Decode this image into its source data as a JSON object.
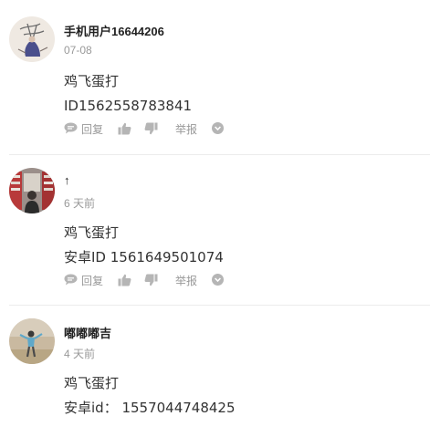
{
  "comments": [
    {
      "username": "手机用户16644206",
      "time": "07-08",
      "lines": [
        "鸡飞蛋打",
        "ID1562558783841"
      ],
      "show_actions": true
    },
    {
      "username": "↑",
      "time": "6 天前",
      "lines": [
        "鸡飞蛋打",
        "安卓ID 1561649501074"
      ],
      "show_actions": true
    },
    {
      "username": "嘟嘟嘟吉",
      "time": "4 天前",
      "lines": [
        "鸡飞蛋打",
        "安卓id： 1557044748425"
      ],
      "show_actions": false
    }
  ],
  "actions": {
    "reply_label": "回复",
    "report_label": "举报",
    "like_icon": "thumbs-up-icon",
    "dislike_icon": "thumbs-down-icon",
    "reply_icon": "speech-bubble-icon",
    "more_icon": "chevron-down-circle-icon"
  },
  "colors": {
    "text": "#333333",
    "muted": "#999999",
    "icon": "#b5b5b5",
    "divider": "#ececec"
  }
}
